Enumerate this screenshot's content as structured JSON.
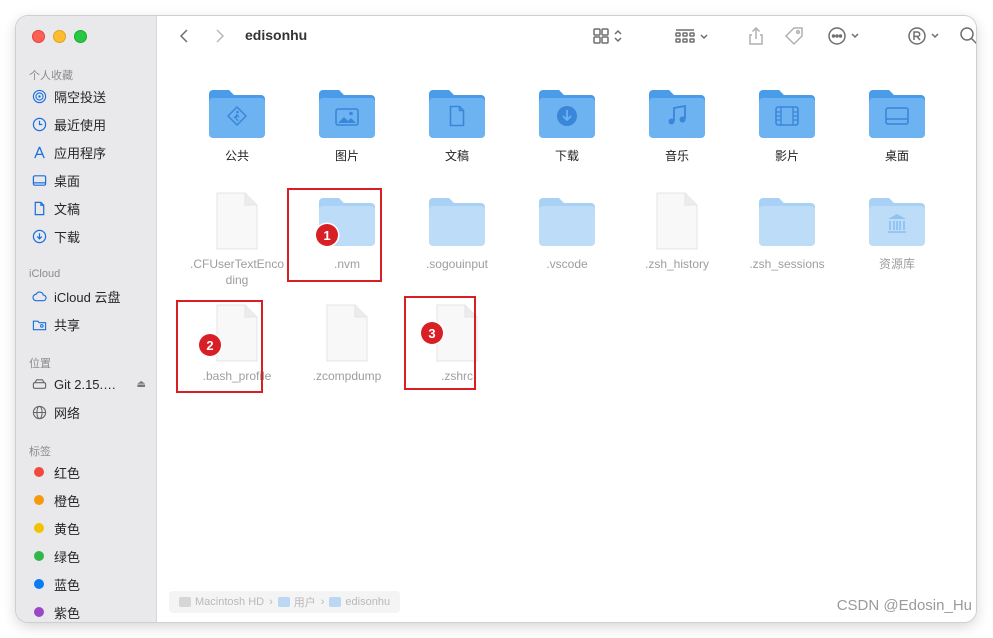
{
  "toolbar": {
    "title": "edisonhu"
  },
  "sidebar": {
    "favorites_header": "个人收藏",
    "favorites": [
      {
        "label": "隔空投送",
        "icon": "airdrop-icon"
      },
      {
        "label": "最近使用",
        "icon": "clock-icon"
      },
      {
        "label": "应用程序",
        "icon": "applications-icon"
      },
      {
        "label": "桌面",
        "icon": "desktop-icon"
      },
      {
        "label": "文稿",
        "icon": "document-icon"
      },
      {
        "label": "下载",
        "icon": "download-icon"
      }
    ],
    "icloud_header": "iCloud",
    "icloud": [
      {
        "label": "iCloud 云盘",
        "icon": "cloud-icon"
      },
      {
        "label": "共享",
        "icon": "shared-folder-icon"
      }
    ],
    "locations_header": "位置",
    "locations": [
      {
        "label": "Git 2.15.…",
        "icon": "disk-icon"
      },
      {
        "label": "网络",
        "icon": "globe-icon"
      }
    ],
    "tags_header": "标签",
    "tags": [
      {
        "label": "红色",
        "color": "#f04a3e"
      },
      {
        "label": "橙色",
        "color": "#f59a0a"
      },
      {
        "label": "黄色",
        "color": "#f2c200"
      },
      {
        "label": "绿色",
        "color": "#2fb74a"
      },
      {
        "label": "蓝色",
        "color": "#0a7bf2"
      },
      {
        "label": "紫色",
        "color": "#9b48c8"
      }
    ]
  },
  "files": {
    "row1": [
      {
        "label": "公共",
        "glyph": "person-walking-icon"
      },
      {
        "label": "图片",
        "glyph": "image-icon"
      },
      {
        "label": "文稿",
        "glyph": "document-icon"
      },
      {
        "label": "下载",
        "glyph": "download-icon"
      },
      {
        "label": "音乐",
        "glyph": "music-icon"
      },
      {
        "label": "影片",
        "glyph": "film-icon"
      },
      {
        "label": "桌面",
        "glyph": "desktop-icon"
      }
    ],
    "row2": [
      {
        "label": ".CFUserTextEncoding",
        "kind": "file"
      },
      {
        "label": ".nvm",
        "kind": "folder"
      },
      {
        "label": ".sogouinput",
        "kind": "folder"
      },
      {
        "label": ".vscode",
        "kind": "folder"
      },
      {
        "label": ".zsh_history",
        "kind": "file"
      },
      {
        "label": ".zsh_sessions",
        "kind": "folder"
      },
      {
        "label": "资源库",
        "kind": "library-folder"
      }
    ],
    "row3": [
      {
        "label": ".bash_profile",
        "kind": "file"
      },
      {
        "label": ".zcompdump",
        "kind": "file"
      },
      {
        "label": ".zshrc",
        "kind": "file"
      }
    ]
  },
  "annotations": [
    "1",
    "2",
    "3"
  ],
  "pathbar": [
    "Macintosh HD",
    "用户",
    "edisonhu"
  ],
  "watermark": "CSDN @Edosin_Hu"
}
